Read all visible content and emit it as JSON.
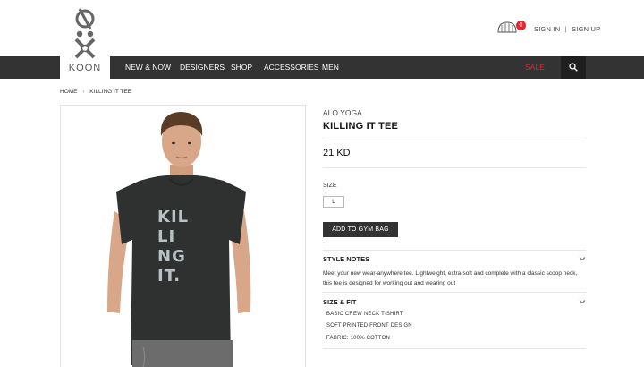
{
  "header": {
    "brand_name": "KOON",
    "cart_count": "0",
    "sign_in": "SIGN IN",
    "separator": "|",
    "sign_up": "SIGN UP"
  },
  "nav": {
    "items": [
      "NEW & NOW",
      "DESIGNERS",
      "SHOP",
      "ACCESSORIES",
      "MEN"
    ],
    "sale": "SALE"
  },
  "breadcrumb": {
    "home": "HOME",
    "current": "KILLING IT TEE"
  },
  "product": {
    "brand": "ALO YOGA",
    "title": "KILLING IT TEE",
    "price": "21 KD",
    "size_label": "SIZE",
    "size_value": "L",
    "add_button": "ADD TO GYM BAG",
    "shirt_print": [
      "KIL",
      "LI",
      "NG",
      "IT."
    ]
  },
  "sections": {
    "style_notes_title": "STYLE NOTES",
    "style_notes_text": "Meet your new wear-anywhere tee. Lightweight, extra-soft and complete with a classic scoop neck, this tee is designed for working out and wearing out",
    "size_fit_title": "SIZE & FIT",
    "size_fit_lines": [
      "BASIC CREW NECK T-SHIRT",
      "SOFT PRINTED FRONT DESIGN",
      "FABRIC: 100% COTTON"
    ]
  },
  "colors": {
    "nav_bg": "#333333",
    "sale": "#e3262f",
    "badge": "#e3262f",
    "button_bg": "#333333"
  },
  "icons": {
    "logo": "koon-logo-icon",
    "cart": "gym-bag-icon",
    "search": "search-icon",
    "chevron": "chevron-down-icon"
  }
}
